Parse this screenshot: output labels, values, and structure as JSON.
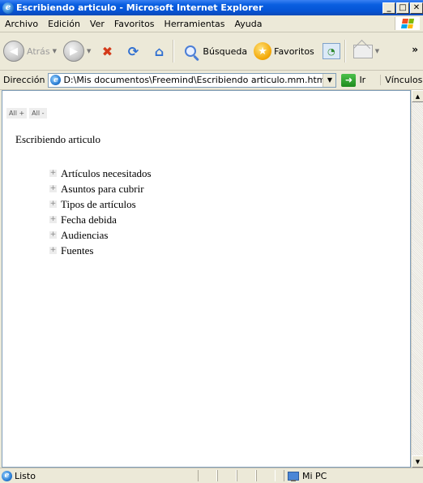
{
  "window": {
    "title": "Escribiendo articulo - Microsoft Internet Explorer",
    "app_icon": "ie-logo-icon",
    "controls": [
      "minimize",
      "maximize",
      "close"
    ]
  },
  "menu": {
    "items": [
      "Archivo",
      "Edición",
      "Ver",
      "Favoritos",
      "Herramientas",
      "Ayuda"
    ]
  },
  "toolbar": {
    "back_label": "Atrás",
    "search_label": "Búsqueda",
    "favorites_label": "Favoritos",
    "more": "»"
  },
  "address": {
    "label": "Dirección",
    "value": "D:\\Mis documentos\\Freemind\\Escribiendo articulo.mm.html",
    "go_label": "Ir",
    "links_label": "Vínculos"
  },
  "page": {
    "expand_all": "All +",
    "collapse_all": "All -",
    "title": "Escribiendo articulo",
    "nodes": [
      {
        "label": "Artículos necesitados"
      },
      {
        "label": "Asuntos para cubrir"
      },
      {
        "label": "Tipos de artículos"
      },
      {
        "label": "Fecha debida"
      },
      {
        "label": "Audiencias"
      },
      {
        "label": "Fuentes"
      }
    ]
  },
  "status": {
    "text": "Listo",
    "zone": "Mi PC"
  },
  "colors": {
    "titlebar": "#0554d6",
    "chrome": "#ece9d8",
    "content_bg": "#ffffff"
  }
}
